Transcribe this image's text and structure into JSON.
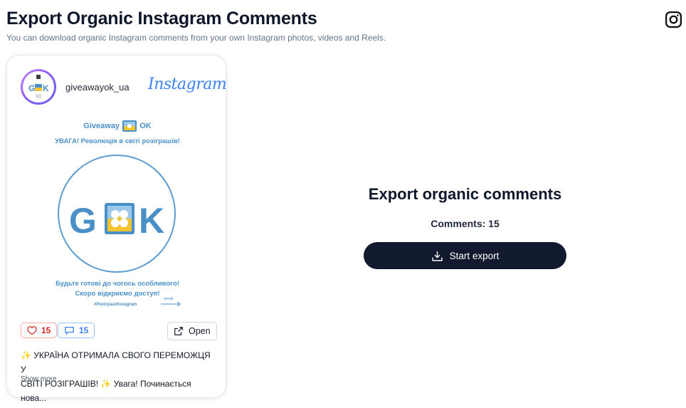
{
  "header": {
    "title": "Export Organic Instagram Comments",
    "subtitle": "You can download organic Instagram comments from your own Instagram photos, videos and Reels.",
    "icon": "instagram-icon"
  },
  "post": {
    "username": "giveawayok_ua",
    "wordmark": "Instagram",
    "image": {
      "brand_left": "Giveaway",
      "brand_right": "OK",
      "headline": "УВАГА! Революція в світі розіграшів!",
      "logo_left": "G",
      "logo_right": "K",
      "avatar_text": "GOK",
      "bottom_line_1": "Будьте готові до чогось особливого!",
      "bottom_line_2": "Скоро відкриємо доступ!",
      "hashtag": "#РозіграшіInstagram",
      "read_label": "читай",
      "colors": {
        "blue": "#4a90c8",
        "yellow": "#f4c430"
      }
    },
    "likes": "15",
    "comments": "15",
    "open_label": "Open",
    "caption_line_1": "✨ УКРАЇНА ОТРИМАЛА СВОГО ПЕРЕМОЖЦЯ У",
    "caption_line_2": "СВІТІ РОЗІГРАШІВ! ✨ Увага! Починається нова...",
    "show_more": "Show more"
  },
  "export": {
    "title": "Export organic comments",
    "comments_label": "Comments: 15",
    "button_label": "Start export",
    "button_color": "#111a2e"
  }
}
